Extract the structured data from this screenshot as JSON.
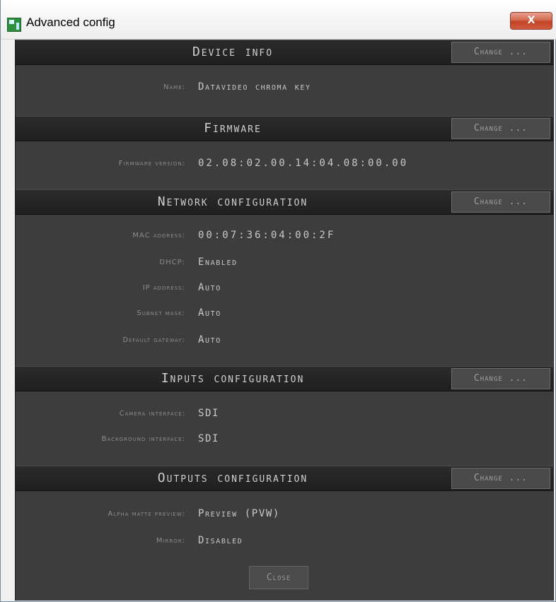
{
  "window": {
    "title": "Advanced config",
    "close_glyph": "X"
  },
  "sections": [
    {
      "title": "Device info",
      "change_label": "Change ...",
      "rows": [
        {
          "label": "Name:",
          "value": "Datavideo chroma key"
        }
      ]
    },
    {
      "title": "Firmware",
      "change_label": "Change ...",
      "rows": [
        {
          "label": "Firmware version:",
          "value": "02.08:02.00.14:04.08:00.00"
        }
      ]
    },
    {
      "title": "Network configuration",
      "change_label": "Change ...",
      "rows": [
        {
          "label": "MAC address:",
          "value": "00:07:36:04:00:2F"
        },
        {
          "label": "DHCP:",
          "value": "Enabled"
        },
        {
          "label": "IP address:",
          "value": "Auto"
        },
        {
          "label": "Subnet mask:",
          "value": "Auto"
        },
        {
          "label": "Default gateway:",
          "value": "Auto"
        }
      ]
    },
    {
      "title": "Inputs configuration",
      "change_label": "Change ...",
      "rows": [
        {
          "label": "Camera interface:",
          "value": "SDI"
        },
        {
          "label": "Background interface:",
          "value": "SDI"
        }
      ]
    },
    {
      "title": "Outputs configuration",
      "change_label": "Change ...",
      "rows": [
        {
          "label": "Alpha matte preview:",
          "value": "Preview (PVW)"
        },
        {
          "label": "Mirror:",
          "value": "Disabled"
        }
      ]
    }
  ],
  "footer": {
    "close_label": "Close"
  }
}
